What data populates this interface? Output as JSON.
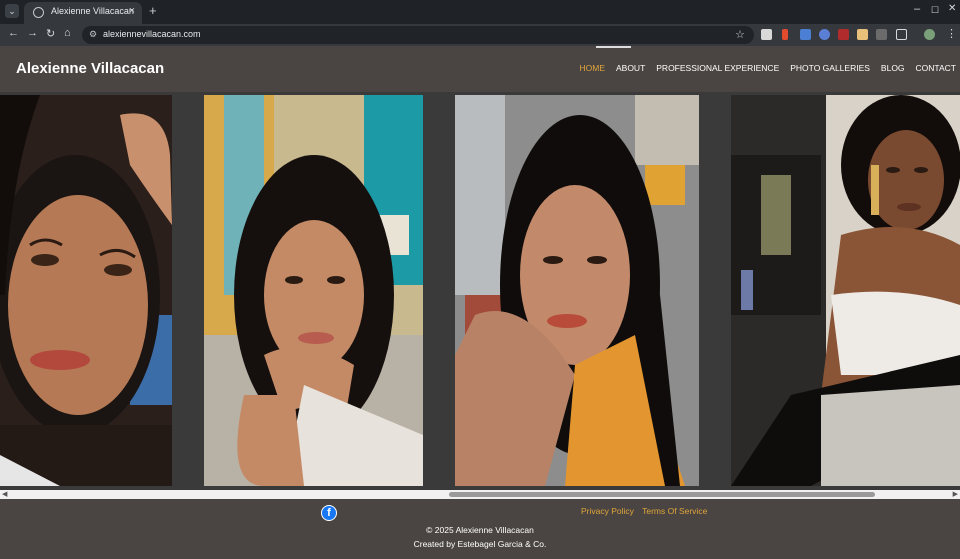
{
  "browser": {
    "tab_title": "Alexienne Villacacan",
    "url": "alexiennevillacacan.com",
    "new_tab_glyph": "+",
    "tab_close_glyph": "×",
    "minimize_glyph": "–",
    "maximize_glyph": "☐",
    "close_glyph": "✕"
  },
  "site": {
    "title": "Alexienne Villacacan",
    "nav": [
      "HOME",
      "ABOUT",
      "PROFESSIONAL EXPERIENCE",
      "PHOTO GALLERIES",
      "BLOG",
      "CONTACT"
    ],
    "active_nav": "HOME",
    "accent_color": "#e0a53a",
    "header_color": "#4a4542"
  },
  "gallery": {
    "photos": [
      {
        "name": "portrait-closeup-hand",
        "alt_icon": "photo-icon"
      },
      {
        "name": "portrait-chin-on-hand",
        "alt_icon": "photo-icon"
      },
      {
        "name": "portrait-selfie-orange-top",
        "alt_icon": "photo-icon"
      },
      {
        "name": "portrait-white-top-earrings",
        "alt_icon": "photo-icon"
      }
    ]
  },
  "footer": {
    "facebook_icon": "facebook-icon",
    "privacy": "Privacy Policy",
    "terms": "Terms Of Service",
    "copyright": "© 2025 Alexienne Villacacan",
    "credit": "Created by Estebagel Garcia & Co."
  }
}
